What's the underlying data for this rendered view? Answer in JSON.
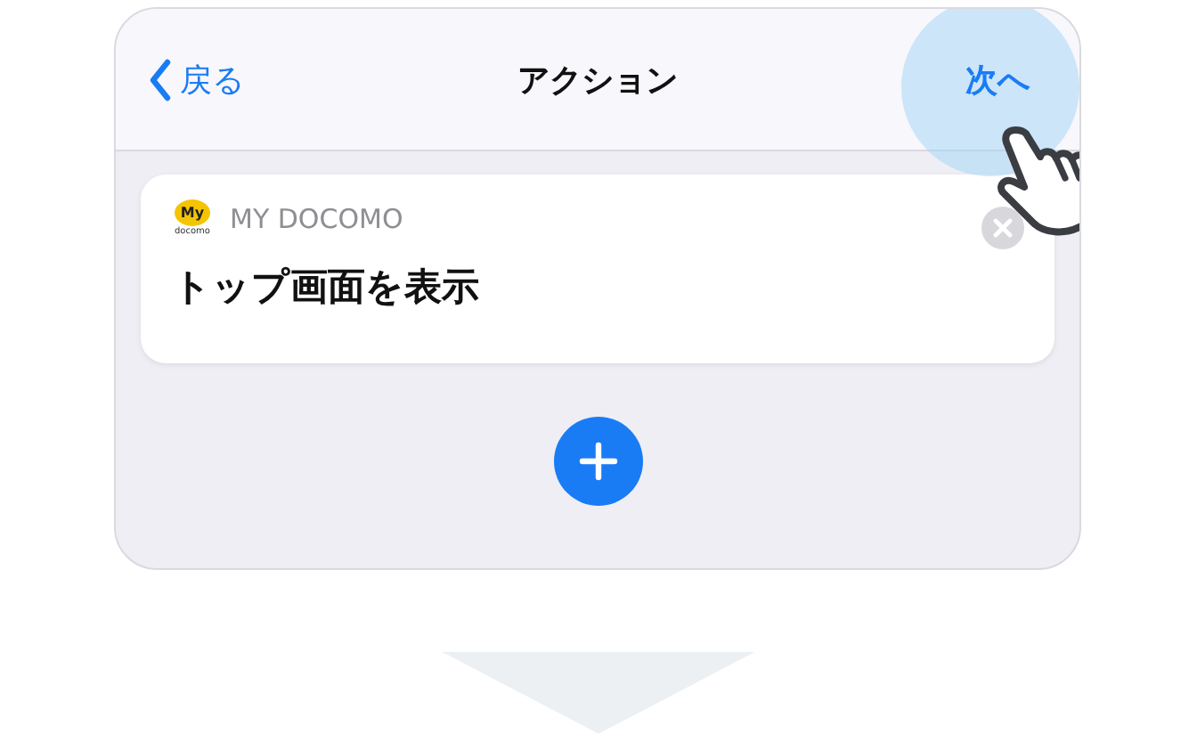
{
  "nav_bar": {
    "back_label": "戻る",
    "title": "アクション",
    "next_label": "次へ"
  },
  "action_card": {
    "app_logo_text": "My",
    "app_logo_subtext": "docomo",
    "app_name": "MY DOCOMO",
    "action": "トップ画面を表示"
  }
}
